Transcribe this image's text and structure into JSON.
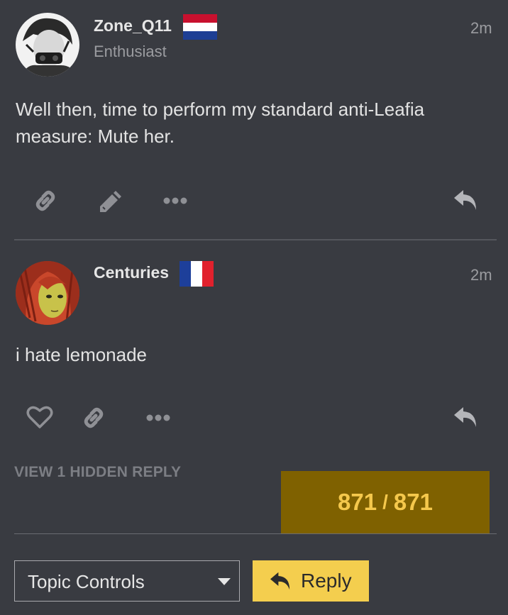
{
  "posts": [
    {
      "username": "Zone_Q11",
      "user_title": "Enthusiast",
      "flag": "netherlands-flag",
      "time": "2m",
      "body": "Well then, time to perform my standard anti-Leafia measure: Mute her.",
      "actions": [
        "link-icon",
        "edit-pencil-icon",
        "more-dots-icon",
        "reply-arrow-icon"
      ]
    },
    {
      "username": "Centuries",
      "flag": "france-flag",
      "time": "2m",
      "body": "i hate lemonade",
      "actions": [
        "heart-icon",
        "link-icon",
        "more-dots-icon",
        "reply-arrow-icon"
      ]
    }
  ],
  "hidden_replies_label": "VIEW 1 HIDDEN REPLY",
  "progress": {
    "current": "871",
    "separator": "/",
    "total": "871"
  },
  "footer": {
    "topic_controls_label": "Topic Controls",
    "reply_label": "Reply"
  },
  "colors": {
    "background": "#393b41",
    "accent": "#f4ce4e",
    "progress_bg": "#7f6100",
    "muted": "#9b9ca0"
  }
}
